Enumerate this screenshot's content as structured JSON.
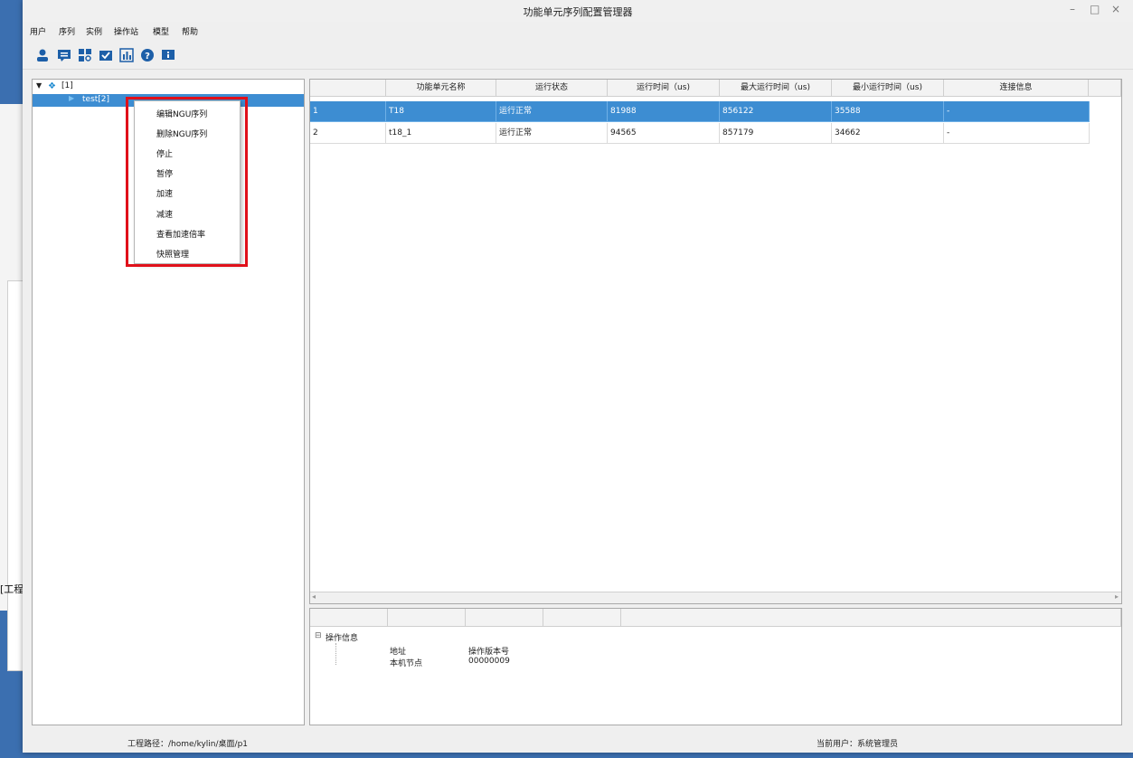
{
  "window": {
    "title": "功能单元序列配置管理器",
    "minimize": "–",
    "maximize": "□",
    "close": "×"
  },
  "menubar": [
    "用户",
    "序列",
    "实例",
    "操作站",
    "模型",
    "帮助"
  ],
  "toolbar_icons": [
    "user-icon",
    "comment-icon",
    "grid-search-icon",
    "mail-check-icon",
    "chart-icon",
    "help-icon",
    "info-icon"
  ],
  "tree": {
    "root": "[1]",
    "child": "test[2]"
  },
  "context_menu": [
    "编辑NGU序列",
    "删除NGU序列",
    "停止",
    "暂停",
    "加速",
    "减速",
    "查看加速倍率",
    "快照管理"
  ],
  "table": {
    "columns": [
      "",
      "功能单元名称",
      "运行状态",
      "运行时间（us)",
      "最大运行时间（us)",
      "最小运行时间（us)",
      "连接信息"
    ],
    "rows": [
      [
        "1",
        "T18",
        "运行正常",
        "81988",
        "856122",
        "35588",
        "-"
      ],
      [
        "2",
        "t18_1",
        "运行正常",
        "94565",
        "857179",
        "34662",
        "-"
      ]
    ]
  },
  "info": {
    "section": "操作信息",
    "r1c1": "地址",
    "r1c2": "操作版本号",
    "r2c1": "本机节点",
    "r2c2": "00000009"
  },
  "status": {
    "path": "工程路径：/home/kylin/桌面/p1",
    "user": "当前用户：系统管理员"
  },
  "background": {
    "text": "[工程"
  },
  "colors": {
    "selection": "#3d8dd2",
    "highlight": "#e0101a",
    "icon": "#1d5fa8"
  }
}
